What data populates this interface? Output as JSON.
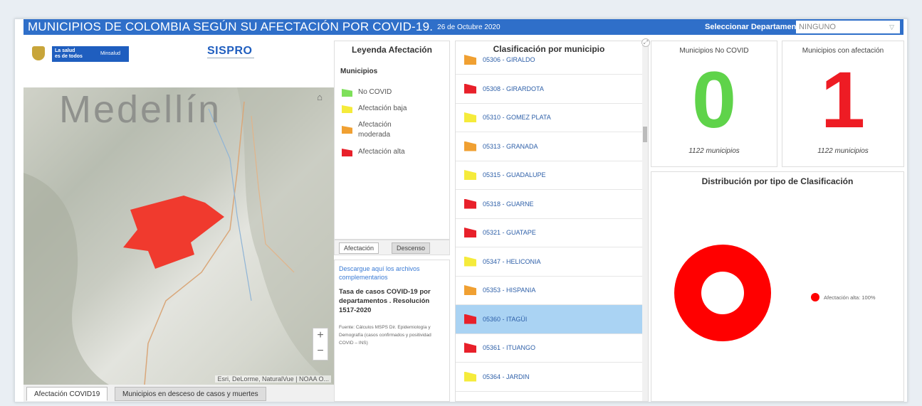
{
  "header": {
    "title": "MUNICIPIOS DE COLOMBIA SEGÚN SU AFECTACIÓN POR COVID-19.",
    "date": "26 de Octubre 2020",
    "select_label": "Seleccionar Departamento",
    "select_value": "NINGUNO"
  },
  "logos": {
    "salud_line1": "La salud",
    "salud_line2": "es de todos",
    "minsalud": "Minsalud",
    "sispro": "SISPRO"
  },
  "map": {
    "city_label": "Medellín",
    "attribution": "Esri, DeLorme, NaturalVue | NOAA O...",
    "zoom_in": "+",
    "zoom_out": "−",
    "tabs": [
      "Afectación COVID19",
      "Municipios en desceso de casos y muertes"
    ]
  },
  "legend": {
    "title": "Leyenda Afectación",
    "subtitle": "Municipios",
    "items": [
      {
        "label": "No COVID",
        "color": "#7ee05a"
      },
      {
        "label": "Afectación baja",
        "color": "#f5eb3b"
      },
      {
        "label": "Afectación moderada",
        "color": "#f0a032"
      },
      {
        "label": "Afectación alta",
        "color": "#e8202a"
      }
    ],
    "tabs": [
      "Afectación",
      "Descenso"
    ]
  },
  "downloads": {
    "link": "Descargue aquí los archivos complementarios",
    "tasa": "Tasa de casos COVID-19 por departamentos . Resolución 1517-2020",
    "source": "Fuente: Cálculos MSPS Dir. Epidemiología y Demografía (casos confirmados y positividad COVID – INS)"
  },
  "classification": {
    "title": "Clasificación por municipio",
    "rows": [
      {
        "label": "05306 - GIRALDO",
        "color": "#f0a032"
      },
      {
        "label": "05308 - GIRARDOTA",
        "color": "#e8202a"
      },
      {
        "label": "05310 - GOMEZ PLATA",
        "color": "#f5eb3b"
      },
      {
        "label": "05313 - GRANADA",
        "color": "#f0a032"
      },
      {
        "label": "05315 - GUADALUPE",
        "color": "#f5eb3b"
      },
      {
        "label": "05318 - GUARNE",
        "color": "#e8202a"
      },
      {
        "label": "05321 - GUATAPE",
        "color": "#e8202a"
      },
      {
        "label": "05347 - HELICONIA",
        "color": "#f5eb3b"
      },
      {
        "label": "05353 - HISPANIA",
        "color": "#f0a032"
      },
      {
        "label": "05360 - ITAGÜI",
        "color": "#e8202a",
        "selected": true
      },
      {
        "label": "05361 - ITUANGO",
        "color": "#e8202a"
      },
      {
        "label": "05364 - JARDIN",
        "color": "#f5eb3b"
      }
    ]
  },
  "stats": {
    "no_covid": {
      "title": "Municipios No COVID",
      "value": "0",
      "sub": "1122 municipios",
      "color": "#5fd34a"
    },
    "afectacion": {
      "title": "Municipios con afectación",
      "value": "1",
      "sub": "1122 municipios",
      "color": "#ee1c24"
    }
  },
  "distribution": {
    "title": "Distribución por tipo de Clasificación",
    "legend_label": "Afectación alta: 100%"
  },
  "chart_data": {
    "type": "pie",
    "categories": [
      "Afectación alta"
    ],
    "values": [
      100
    ],
    "colors": [
      "#ff0000"
    ],
    "legend_position": "right"
  }
}
